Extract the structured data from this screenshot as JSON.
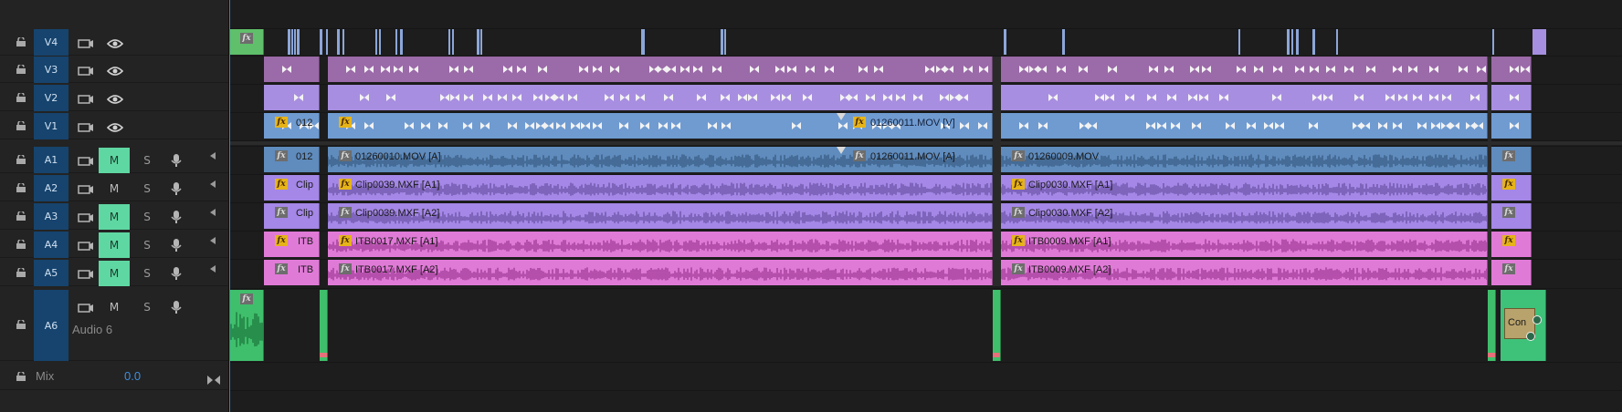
{
  "colors": {
    "video_blue": "#6f9bd1",
    "video_purple": "#a78ee0",
    "video_mauve": "#9d6faa",
    "audio_a1": "#5f8bbd",
    "audio_purple": "#a487e6",
    "audio_pink": "#e07ad7",
    "audio_green": "#3ec27a",
    "track_target_blue": "#16446e",
    "mute_green": "#5fd7a2",
    "playhead": "#2e7fd6"
  },
  "video_tracks": [
    {
      "label": "V4",
      "icons": [
        "lock-icon",
        "film-icon",
        "eye-icon"
      ]
    },
    {
      "label": "V3",
      "icons": [
        "lock-icon",
        "film-icon",
        "eye-icon"
      ]
    },
    {
      "label": "V2",
      "icons": [
        "lock-icon",
        "film-icon",
        "eye-icon"
      ]
    },
    {
      "label": "V1",
      "icons": [
        "lock-icon",
        "film-icon",
        "eye-icon"
      ]
    }
  ],
  "audio_tracks": [
    {
      "label": "A1",
      "mute": "M",
      "solo": "S",
      "muted": true
    },
    {
      "label": "A2",
      "mute": "M",
      "solo": "S",
      "muted": false
    },
    {
      "label": "A3",
      "mute": "M",
      "solo": "S",
      "muted": true
    },
    {
      "label": "A4",
      "mute": "M",
      "solo": "S",
      "muted": true
    },
    {
      "label": "A5",
      "mute": "M",
      "solo": "S",
      "muted": true
    },
    {
      "label": "A6",
      "mute": "M",
      "solo": "S",
      "muted": false,
      "name": "Audio 6"
    }
  ],
  "mix": {
    "label": "Mix",
    "value": "0.0"
  },
  "clips": {
    "v1": [
      {
        "name": "012",
        "fx": true
      },
      {
        "name": "",
        "fx": true
      },
      {
        "name": "01260011.MOV [V]",
        "fx": true
      }
    ],
    "a1": [
      {
        "name": "012"
      },
      {
        "name": "01260010.MOV [A]"
      },
      {
        "name": "01260011.MOV [A]"
      },
      {
        "name": "01260009.MOV"
      }
    ],
    "a2": [
      {
        "name": "Clip"
      },
      {
        "name": "Clip0039.MXF [A1]"
      },
      {
        "name": "Clip0030.MXF [A1]"
      }
    ],
    "a3": [
      {
        "name": "Clip"
      },
      {
        "name": "Clip0039.MXF [A2]"
      },
      {
        "name": "Clip0030.MXF [A2]"
      }
    ],
    "a4": [
      {
        "name": "ITB"
      },
      {
        "name": "ITB0017.MXF [A1]"
      },
      {
        "name": "ITB0009.MXF [A1]"
      }
    ],
    "a5": [
      {
        "name": "ITB"
      },
      {
        "name": "ITB0017.MXF [A2]"
      },
      {
        "name": "ITB0009.MXF [A2]"
      }
    ],
    "a6": [
      {
        "name": "Con"
      }
    ]
  }
}
